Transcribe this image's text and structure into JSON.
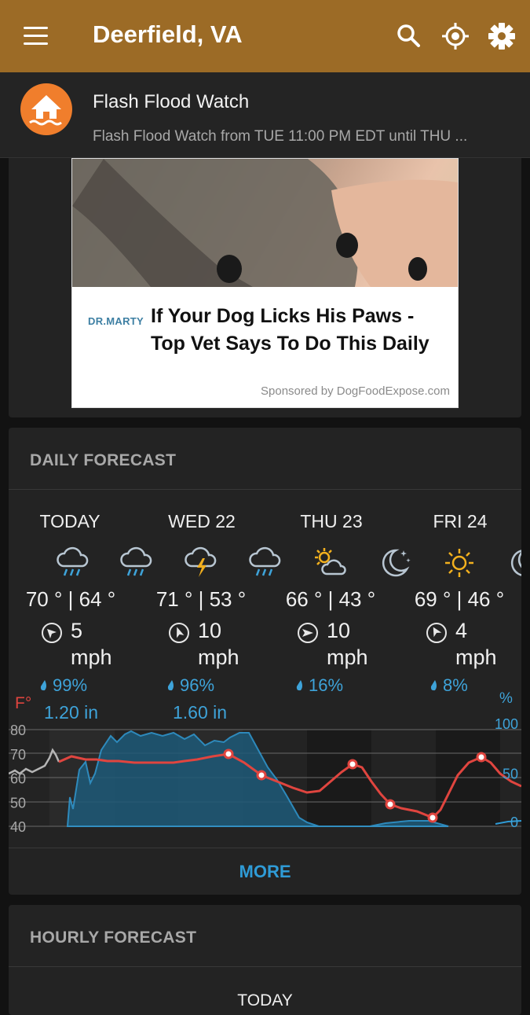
{
  "app": {
    "title": "Deerfield, VA",
    "bar_color": "#9c6b26"
  },
  "toolbar": {
    "icons": [
      "menu-icon",
      "search-icon",
      "locate-icon",
      "settings-icon"
    ]
  },
  "alert": {
    "title": "Flash Flood Watch",
    "detail": "Flash Flood Watch from TUE 11:00 PM EDT until THU ...",
    "icon": "flood-house-icon"
  },
  "ad": {
    "brand": "DR.MARTY",
    "headline": "If Your Dog Licks His Paws - Top Vet Says To Do This Daily",
    "sponsor": "Sponsored by DogFoodExpose.com"
  },
  "daily": {
    "section_title": "DAILY FORECAST",
    "days": [
      {
        "label": "TODAY",
        "temps": "70 ° | 64 °",
        "wind_speed": "5",
        "wind_unit": "mph",
        "precip_chance": "99%",
        "precip_amount": "1.20 in"
      },
      {
        "label": "WED 22",
        "temps": "71 ° | 53 °",
        "wind_speed": "10",
        "wind_unit": "mph",
        "precip_chance": "96%",
        "precip_amount": "1.60 in"
      },
      {
        "label": "THU 23",
        "temps": "66 ° | 43 °",
        "wind_speed": "10",
        "wind_unit": "mph",
        "precip_chance": "16%",
        "precip_amount": ""
      },
      {
        "label": "FRI 24",
        "temps": "69 ° | 46 °",
        "wind_speed": "4",
        "wind_unit": "mph",
        "precip_chance": "8%",
        "precip_amount": ""
      }
    ],
    "weather_icons": [
      "rain-icon",
      "rain-icon",
      "thunderstorm-icon",
      "rain-icon",
      "partly-cloudy-icon",
      "clear-night-icon",
      "sunny-icon",
      "clear-night-icon"
    ],
    "temp_axis_label": "F°",
    "precip_axis_label": "%",
    "more_label": "MORE",
    "colors": {
      "temperature": "#e0453f",
      "precipitation": "#3ea3d9"
    }
  },
  "chart_data": {
    "type": "line",
    "x": [
      "TODAY",
      "WED 22",
      "THU 23",
      "FRI 24"
    ],
    "left_axis": {
      "ticks": [
        "80",
        "70",
        "60",
        "50",
        "40"
      ],
      "ylim": [
        40,
        80
      ]
    },
    "right_axis": {
      "ticks": [
        "100",
        "50",
        "0"
      ],
      "ylim": [
        0,
        100
      ]
    },
    "series": [
      {
        "name": "F°",
        "kind": "temperature",
        "marked_points": [
          70,
          61,
          66,
          49,
          43,
          68
        ]
      },
      {
        "name": "%",
        "kind": "precipitation",
        "values": [
          99,
          96,
          16,
          8
        ]
      }
    ]
  },
  "hourly": {
    "section_title": "HOURLY FORECAST",
    "first_label": "TODAY"
  }
}
